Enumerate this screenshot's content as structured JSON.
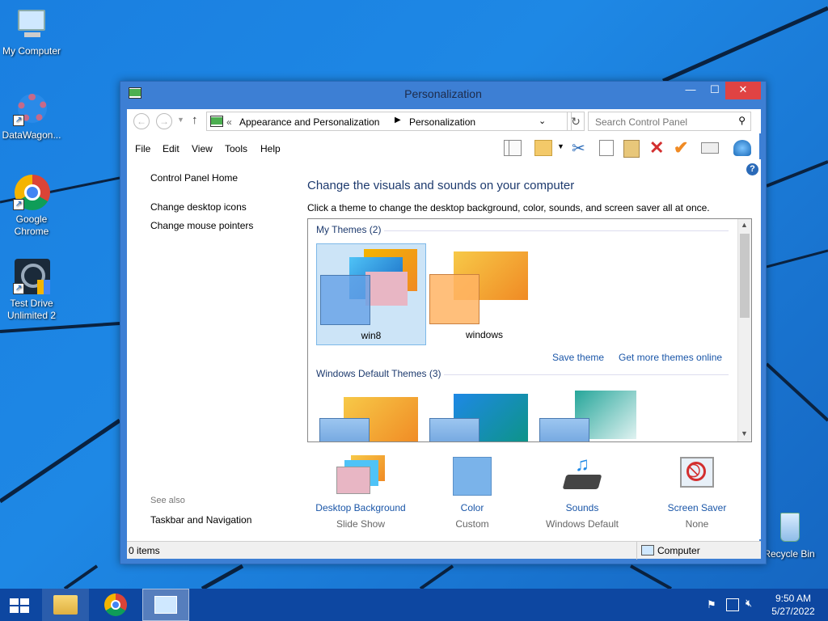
{
  "desktop": {
    "icons": [
      {
        "label": "My Computer"
      },
      {
        "label": "DataWagon..."
      },
      {
        "label": "Google Chrome"
      },
      {
        "label": "Test Drive Unlimited 2"
      },
      {
        "label": "Recycle Bin"
      }
    ]
  },
  "window": {
    "title": "Personalization",
    "address": {
      "prefix": "«",
      "crumb1": "Appearance and Personalization",
      "crumb2": "Personalization",
      "search_placeholder": "Search Control Panel"
    },
    "menu": [
      "File",
      "Edit",
      "View",
      "Tools",
      "Help"
    ],
    "left": {
      "home": "Control Panel Home",
      "links": [
        "Change desktop icons",
        "Change mouse pointers"
      ],
      "see_also": "See also",
      "taskbar": "Taskbar and Navigation"
    },
    "main": {
      "heading": "Change the visuals and sounds on your computer",
      "subheading": "Click a theme to change the desktop background, color, sounds, and screen saver all at once.",
      "my_themes": "My Themes (2)",
      "themes": [
        "win8",
        "windows"
      ],
      "save_theme": "Save theme",
      "get_more": "Get more themes online",
      "default_themes": "Windows Default Themes (3)"
    },
    "bottom": [
      {
        "title": "Desktop Background",
        "value": "Slide Show"
      },
      {
        "title": "Color",
        "value": "Custom"
      },
      {
        "title": "Sounds",
        "value": "Windows Default"
      },
      {
        "title": "Screen Saver",
        "value": "None"
      }
    ],
    "status": {
      "items": "0 items",
      "location": "Computer"
    }
  },
  "taskbar": {
    "time": "9:50 AM",
    "date": "5/27/2022"
  },
  "colors": {
    "accent": "#3d7fd4",
    "link": "#1a56a8",
    "desktop": "#1e88e5",
    "taskbar": "#0d47a1"
  }
}
